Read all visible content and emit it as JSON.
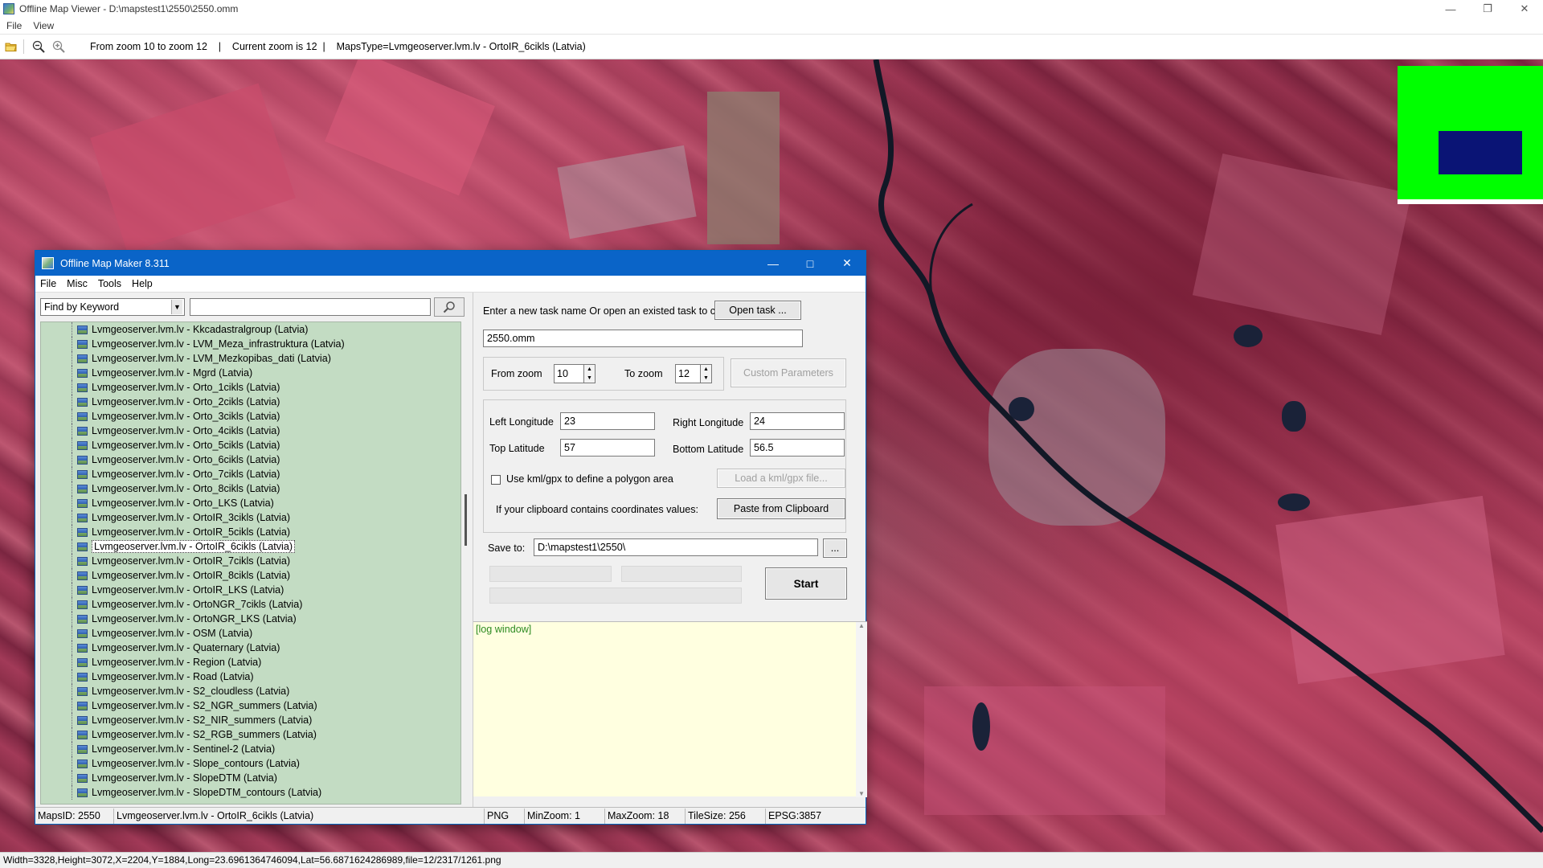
{
  "viewer": {
    "title": "Offline Map Viewer - D:\\mapstest1\\2550\\2550.omm",
    "menu": [
      "File",
      "View"
    ],
    "toolbar": {
      "status": "From zoom 10 to zoom 12    |    Current zoom is 12  |    MapsType=Lvmgeoserver.lvm.lv - OrtoIR_6cikls (Latvia)"
    },
    "statusbar": "Width=3328,Height=3072,X=2204,Y=1884,Long=23.6961364746094,Lat=56.6871624286989,file=12/2317/1261.png",
    "colors": {
      "overview_bg": "#00ff00",
      "overview_view": "#0a1475"
    }
  },
  "omm": {
    "title": "Offline Map Maker 8.311",
    "menu": [
      "File",
      "Misc",
      "Tools",
      "Help"
    ],
    "search": {
      "mode": "Find by Keyword",
      "query": ""
    },
    "map_list": [
      "Lvmgeoserver.lvm.lv - Kkcadastralgroup (Latvia)",
      "Lvmgeoserver.lvm.lv - LVM_Meza_infrastruktura (Latvia)",
      "Lvmgeoserver.lvm.lv - LVM_Mezkopibas_dati (Latvia)",
      "Lvmgeoserver.lvm.lv - Mgrd (Latvia)",
      "Lvmgeoserver.lvm.lv - Orto_1cikls (Latvia)",
      "Lvmgeoserver.lvm.lv - Orto_2cikls (Latvia)",
      "Lvmgeoserver.lvm.lv - Orto_3cikls (Latvia)",
      "Lvmgeoserver.lvm.lv - Orto_4cikls (Latvia)",
      "Lvmgeoserver.lvm.lv - Orto_5cikls (Latvia)",
      "Lvmgeoserver.lvm.lv - Orto_6cikls (Latvia)",
      "Lvmgeoserver.lvm.lv - Orto_7cikls (Latvia)",
      "Lvmgeoserver.lvm.lv - Orto_8cikls (Latvia)",
      "Lvmgeoserver.lvm.lv - Orto_LKS (Latvia)",
      "Lvmgeoserver.lvm.lv - OrtoIR_3cikls (Latvia)",
      "Lvmgeoserver.lvm.lv - OrtoIR_5cikls (Latvia)",
      "Lvmgeoserver.lvm.lv - OrtoIR_6cikls (Latvia)",
      "Lvmgeoserver.lvm.lv - OrtoIR_7cikls (Latvia)",
      "Lvmgeoserver.lvm.lv - OrtoIR_8cikls (Latvia)",
      "Lvmgeoserver.lvm.lv - OrtoIR_LKS (Latvia)",
      "Lvmgeoserver.lvm.lv - OrtoNGR_7cikls (Latvia)",
      "Lvmgeoserver.lvm.lv - OrtoNGR_LKS (Latvia)",
      "Lvmgeoserver.lvm.lv - OSM (Latvia)",
      "Lvmgeoserver.lvm.lv - Quaternary (Latvia)",
      "Lvmgeoserver.lvm.lv - Region (Latvia)",
      "Lvmgeoserver.lvm.lv - Road (Latvia)",
      "Lvmgeoserver.lvm.lv - S2_cloudless (Latvia)",
      "Lvmgeoserver.lvm.lv - S2_NGR_summers (Latvia)",
      "Lvmgeoserver.lvm.lv - S2_NIR_summers (Latvia)",
      "Lvmgeoserver.lvm.lv - S2_RGB_summers (Latvia)",
      "Lvmgeoserver.lvm.lv - Sentinel-2 (Latvia)",
      "Lvmgeoserver.lvm.lv - Slope_contours (Latvia)",
      "Lvmgeoserver.lvm.lv - SlopeDTM (Latvia)",
      "Lvmgeoserver.lvm.lv - SlopeDTM_contours (Latvia)"
    ],
    "selected_index": 15,
    "task": {
      "prompt": "Enter a new task name Or open an existed task to continue:",
      "open_label": "Open task ...",
      "name": "2550.omm"
    },
    "zoom": {
      "from_label": "From zoom",
      "from_value": "10",
      "to_label": "To zoom",
      "to_value": "12",
      "custom_label": "Custom Parameters"
    },
    "bounds": {
      "left_label": "Left Longitude",
      "left_value": "23",
      "right_label": "Right Longitude",
      "right_value": "24",
      "top_label": "Top Latitude",
      "top_value": "57",
      "bottom_label": "Bottom Latitude",
      "bottom_value": "56.5"
    },
    "kml": {
      "checkbox_label": "Use kml/gpx to define a polygon area",
      "load_label": "Load a kml/gpx file..."
    },
    "clipboard": {
      "prompt": "If your clipboard contains coordinates values:",
      "paste_label": "Paste from Clipboard"
    },
    "save": {
      "label": "Save to:",
      "path": "D:\\mapstest1\\2550\\",
      "browse_label": "..."
    },
    "start_label": "Start",
    "log_text": "[log window]",
    "statusbar": {
      "maps_id": "MapsID: 2550",
      "map_name": "Lvmgeoserver.lvm.lv - OrtoIR_6cikls (Latvia)",
      "format": "PNG",
      "min_zoom": "MinZoom: 1",
      "max_zoom": "MaxZoom: 18",
      "tile_size": "TileSize: 256",
      "epsg": "EPSG:3857"
    }
  }
}
